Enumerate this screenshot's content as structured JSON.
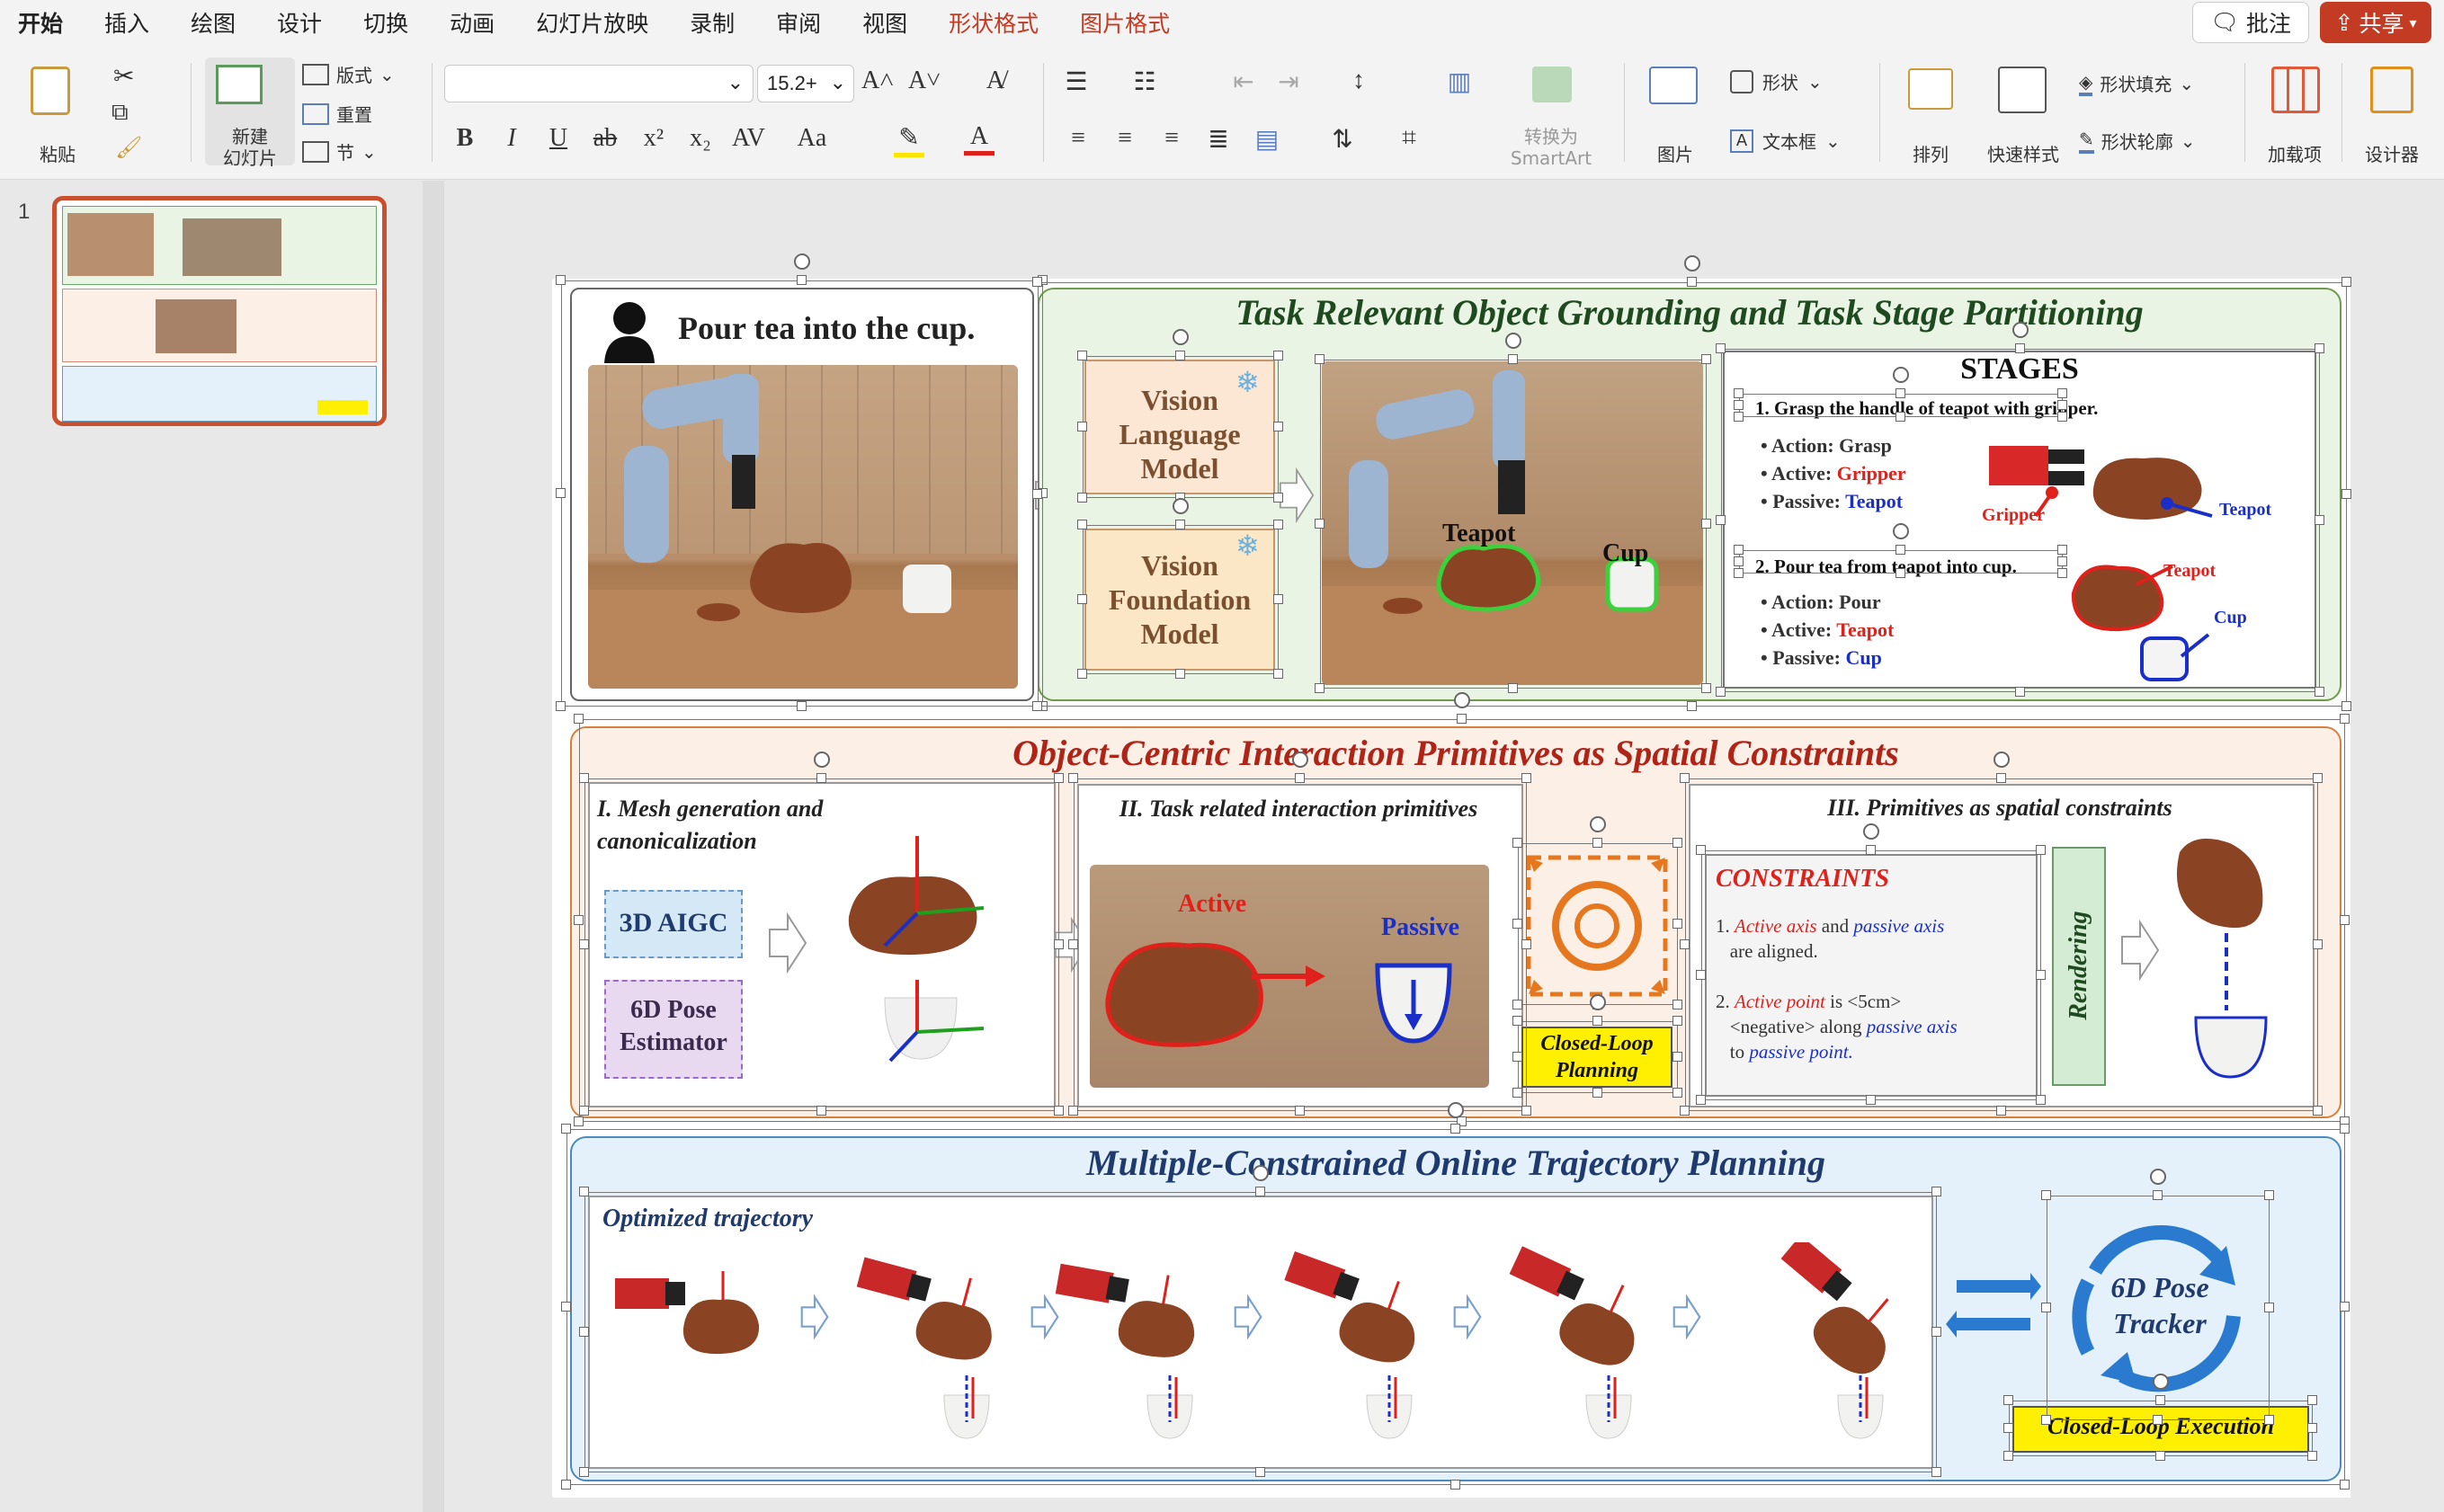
{
  "menu": {
    "tabs": [
      "开始",
      "插入",
      "绘图",
      "设计",
      "切换",
      "动画",
      "幻灯片放映",
      "录制",
      "审阅",
      "视图",
      "形状格式",
      "图片格式"
    ],
    "comment": "批注",
    "share": "共享"
  },
  "ribbon": {
    "paste": "粘贴",
    "new_slide": "新建\n幻灯片",
    "layout": "版式",
    "reset": "重置",
    "section": "节",
    "font_size": "15.2+",
    "convert_smartart": "转换为\nSmartArt",
    "picture": "图片",
    "shape": "形状",
    "textbox": "文本框",
    "arrange": "排列",
    "quick_styles": "快速样式",
    "shape_fill": "形状填充",
    "shape_outline": "形状轮廓",
    "addins": "加载项",
    "designer": "设计器"
  },
  "thumbnails": {
    "slide_number": "1"
  },
  "slide": {
    "top_left": {
      "instruction": "Pour tea into the cup."
    },
    "grounding": {
      "title": "Task Relevant Object Grounding and Task Stage Partitioning",
      "vlm": "Vision Language Model",
      "vfm": "Vision Foundation Model",
      "teapot_label": "Teapot",
      "cup_label": "Cup",
      "stages_title": "STAGES",
      "stage1": {
        "heading": "1. Grasp the handle of teapot with gripper.",
        "action_k": "Action: ",
        "action_v": "Grasp",
        "active_k": "Active: ",
        "active_v": "Gripper",
        "passive_k": "Passive: ",
        "passive_v": "Teapot",
        "fig_gripper": "Gripper",
        "fig_teapot": "Teapot"
      },
      "stage2": {
        "heading": "2. Pour tea from teapot into cup.",
        "action_k": "Action: ",
        "action_v": "Pour",
        "active_k": "Active: ",
        "active_v": "Teapot",
        "passive_k": "Passive: ",
        "passive_v": "Cup",
        "fig_teapot": "Teapot",
        "fig_cup": "Cup"
      }
    },
    "primitives": {
      "title": "Object-Centric Interaction Primitives as Spatial Constraints",
      "sec1": "I. Mesh generation and canonicalization",
      "aigc": "3D AIGC",
      "pose": "6D Pose Estimator",
      "sec2": "II. Task related interaction primitives",
      "active": "Active",
      "passive": "Passive",
      "closed_loop_planning": "Closed-Loop Planning",
      "sec3": "III. Primitives as spatial constraints",
      "constraints": "CONSTRAINTS",
      "c1_a": "Active axis",
      "c1_b": " and ",
      "c1_c": "passive axis",
      "c1_d": "are aligned.",
      "c2_a": "Active point",
      "c2_b": " is <5cm>",
      "c2_c": "<negative> along ",
      "c2_d": "passive axis",
      "c2_e": "to ",
      "c2_f": "passive point.",
      "rendering": "Rendering"
    },
    "trajectory": {
      "title": "Multiple-Constrained Online Trajectory Planning",
      "optimized": "Optimized trajectory",
      "tracker": "6D Pose Tracker",
      "closed_loop_execution": "Closed-Loop Execution"
    }
  },
  "colors": {
    "accent_red": "#c23b22",
    "green_panel": "#eaf4e4",
    "orange_panel": "#fcefe6",
    "blue_panel": "#e4f1fa",
    "title_blue": "#1f3a6e",
    "title_red": "#b02418",
    "yellow": "#ffef00"
  }
}
